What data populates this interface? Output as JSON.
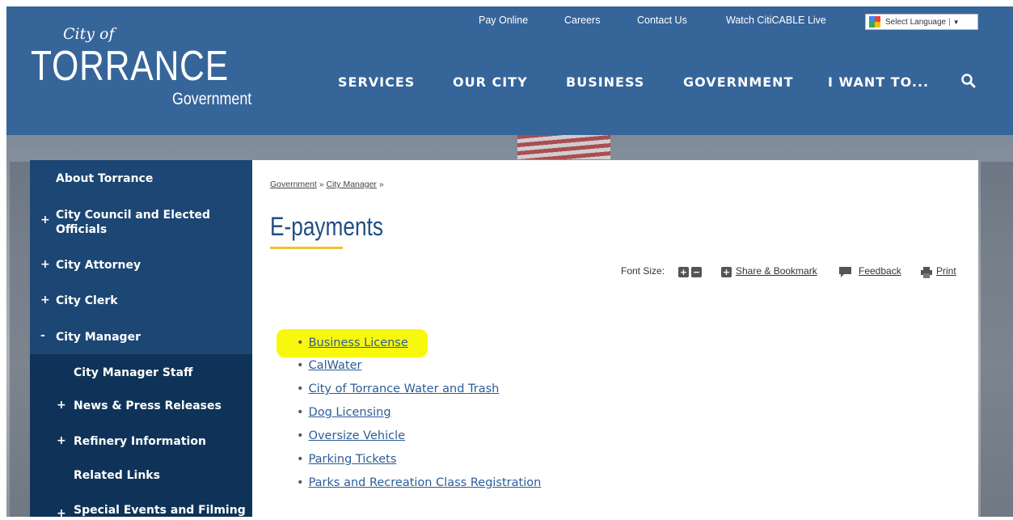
{
  "header": {
    "logo": {
      "city_of": "City of",
      "torrance": "TORRANCE",
      "government": "Government"
    },
    "utility_links": [
      "Pay Online",
      "Careers",
      "Contact Us",
      "Watch CitiCABLE Live"
    ],
    "language": {
      "label": "Select Language",
      "separator": "|",
      "caret": "▼"
    },
    "nav": [
      "SERVICES",
      "OUR CITY",
      "BUSINESS",
      "GOVERNMENT",
      "I WANT TO..."
    ],
    "search_icon": "search-icon"
  },
  "sidebar": {
    "items": [
      {
        "label": "About Torrance",
        "marker": ""
      },
      {
        "label": "City Council and Elected Officials",
        "marker": "+"
      },
      {
        "label": "City Attorney",
        "marker": "+"
      },
      {
        "label": "City Clerk",
        "marker": "+"
      },
      {
        "label": "City Manager",
        "marker": "-"
      }
    ],
    "sub_items": [
      {
        "label": "City Manager Staff",
        "marker": ""
      },
      {
        "label": "News & Press Releases",
        "marker": "+"
      },
      {
        "label": "Refinery Information",
        "marker": "+"
      },
      {
        "label": "Related Links",
        "marker": ""
      },
      {
        "label": "Special Events and Filming",
        "marker": "+"
      }
    ]
  },
  "main": {
    "breadcrumb": {
      "item1": "Government",
      "sep1": "»",
      "item2": "City Manager",
      "sep2": "»"
    },
    "title": "E-payments",
    "tools": {
      "font_size_label": "Font Size:",
      "plus": "+",
      "minus": "−",
      "share_label": "Share & Bookmark",
      "feedback_label": "Feedback",
      "print_label": "Print"
    },
    "links": [
      "Business License",
      "CalWater",
      "City of Torrance Water and Trash",
      "Dog Licensing",
      "Oversize Vehicle",
      "Parking Tickets",
      "Parks and Recreation Class Registration"
    ],
    "bullet": "•"
  },
  "colors": {
    "header_bg": "#36659a",
    "sidebar_bg": "#1c4673",
    "sidebar_sub_bg": "#0f3358",
    "title_color": "#1f4e84",
    "title_rule": "#f2c12e",
    "link_color": "#2b5d97",
    "highlight": "#f8f80c"
  }
}
